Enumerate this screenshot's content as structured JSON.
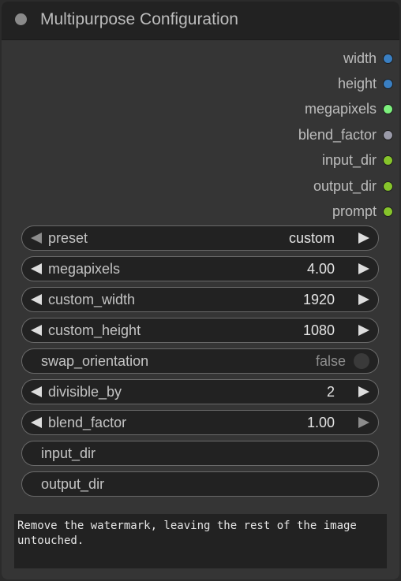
{
  "node": {
    "title": "Multipurpose Configuration",
    "outputs": [
      {
        "label": "width",
        "color": "#3a7fc2"
      },
      {
        "label": "height",
        "color": "#3a7fc2"
      },
      {
        "label": "megapixels",
        "color": "#7df07d"
      },
      {
        "label": "blend_factor",
        "color": "#9a9aa8"
      },
      {
        "label": "input_dir",
        "color": "#86c42b"
      },
      {
        "label": "output_dir",
        "color": "#86c42b"
      },
      {
        "label": "prompt",
        "color": "#86c42b"
      }
    ],
    "widgets": {
      "preset": {
        "label": "preset",
        "value": "custom"
      },
      "megapixels": {
        "label": "megapixels",
        "value": "4.00"
      },
      "custom_width": {
        "label": "custom_width",
        "value": "1920"
      },
      "custom_height": {
        "label": "custom_height",
        "value": "1080"
      },
      "swap_orientation": {
        "label": "swap_orientation",
        "value": "false"
      },
      "divisible_by": {
        "label": "divisible_by",
        "value": "2"
      },
      "blend_factor": {
        "label": "blend_factor",
        "value": "1.00"
      },
      "input_dir": {
        "label": "input_dir"
      },
      "output_dir": {
        "label": "output_dir"
      }
    },
    "prompt_text": "Remove the watermark, leaving the rest of the image untouched."
  }
}
